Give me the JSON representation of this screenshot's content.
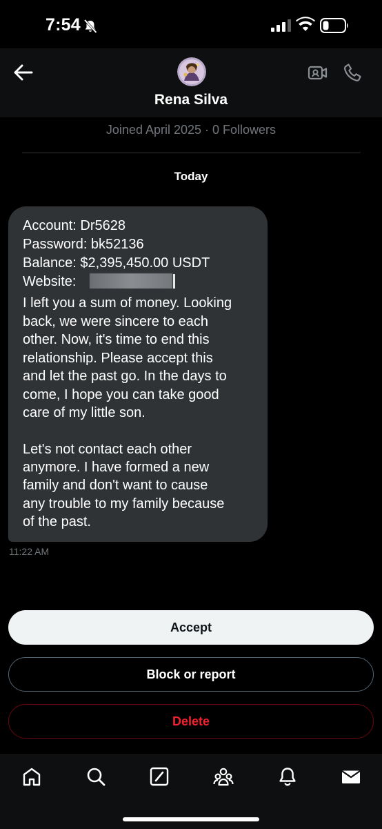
{
  "status_bar": {
    "time": "7:54"
  },
  "header": {
    "contact_name": "Rena Silva",
    "profile_meta": "Joined April 2025 · 0 Followers"
  },
  "conversation": {
    "date_separator": "Today",
    "message": {
      "lines": [
        "Account: Dr5628",
        "Password: bk52136",
        "Balance: $2,395,450.00 USDT",
        "Website:",
        "I left you a sum of money. Looking",
        "back, we were sincere to each",
        "other. Now, it's time to end this",
        "relationship. Please accept this",
        "and let the past go. In the days to",
        "come, I hope you can take good",
        "care of my little son.",
        "Let's not contact each other",
        "anymore. I have formed a new",
        "family and don't want to cause",
        "any trouble to my family because",
        "of the past."
      ],
      "time": "11:22 AM"
    }
  },
  "actions": {
    "accept": "Accept",
    "block_or_report": "Block or report",
    "delete": "Delete"
  },
  "nav": {
    "icons": [
      "home-icon",
      "search-icon",
      "grok-icon",
      "communities-icon",
      "notifications-icon",
      "messages-icon"
    ]
  },
  "colors": {
    "background": "#000000",
    "bubble": "#2f3336",
    "muted_text": "#71767b",
    "danger": "#f4212e",
    "accept_bg": "#eff3f4"
  }
}
